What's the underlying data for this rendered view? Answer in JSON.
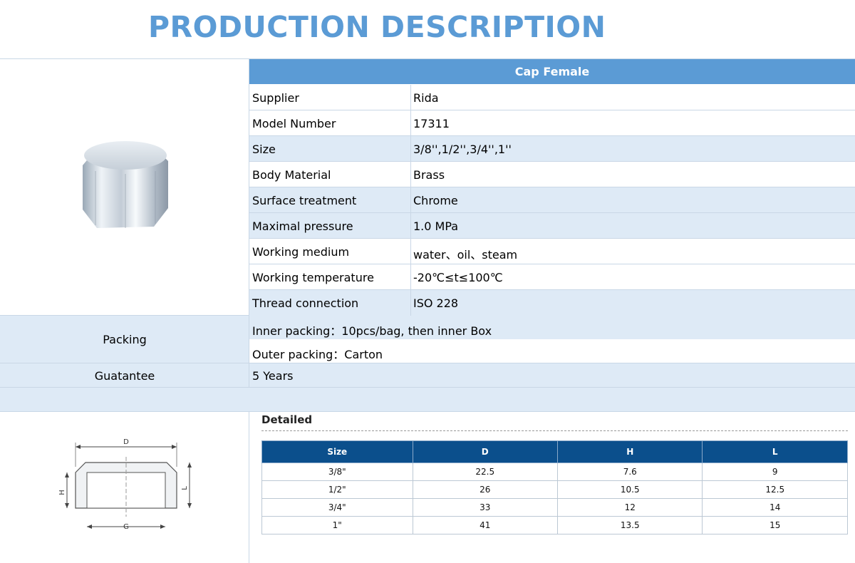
{
  "page": {
    "title": "PRODUCTION DESCRIPTION"
  },
  "product": {
    "name": "Cap Female",
    "specs": [
      {
        "key": "Supplier",
        "value": "Rida"
      },
      {
        "key": "Model Number",
        "value": "17311"
      },
      {
        "key": "Size",
        "value": "3/8'',1/2'',3/4'',1''"
      },
      {
        "key": "Body Material",
        "value": "Brass"
      },
      {
        "key": "Surface treatment",
        "value": "Chrome"
      },
      {
        "key": "Maximal pressure",
        "value": "1.0 MPa"
      },
      {
        "key": "Working medium",
        "value": "water、oil、steam"
      },
      {
        "key": "Working temperature",
        "value": "-20℃≤t≤100℃"
      },
      {
        "key": "Thread connection",
        "value": "ISO 228"
      }
    ]
  },
  "packing": {
    "label": "Packing",
    "inner": "Inner packing：10pcs/bag, then inner Box",
    "outer": "Outer packing：Carton"
  },
  "guarantee": {
    "label": "Guatantee",
    "value": "5 Years"
  },
  "drawing": {
    "labels": {
      "d": "D",
      "g": "G",
      "h": "H",
      "l": "L"
    }
  },
  "detailed": {
    "title": "Detailed",
    "columns": [
      "Size",
      "D",
      "H",
      "L"
    ],
    "rows": [
      [
        "3/8\"",
        "22.5",
        "7.6",
        "9"
      ],
      [
        "1/2\"",
        "26",
        "10.5",
        "12.5"
      ],
      [
        "3/4\"",
        "33",
        "12",
        "14"
      ],
      [
        "1\"",
        "41",
        "13.5",
        "15"
      ]
    ]
  },
  "colors": {
    "accent": "#5b9bd5",
    "band": "#deeaf6",
    "table_header": "#0b4f8c"
  }
}
